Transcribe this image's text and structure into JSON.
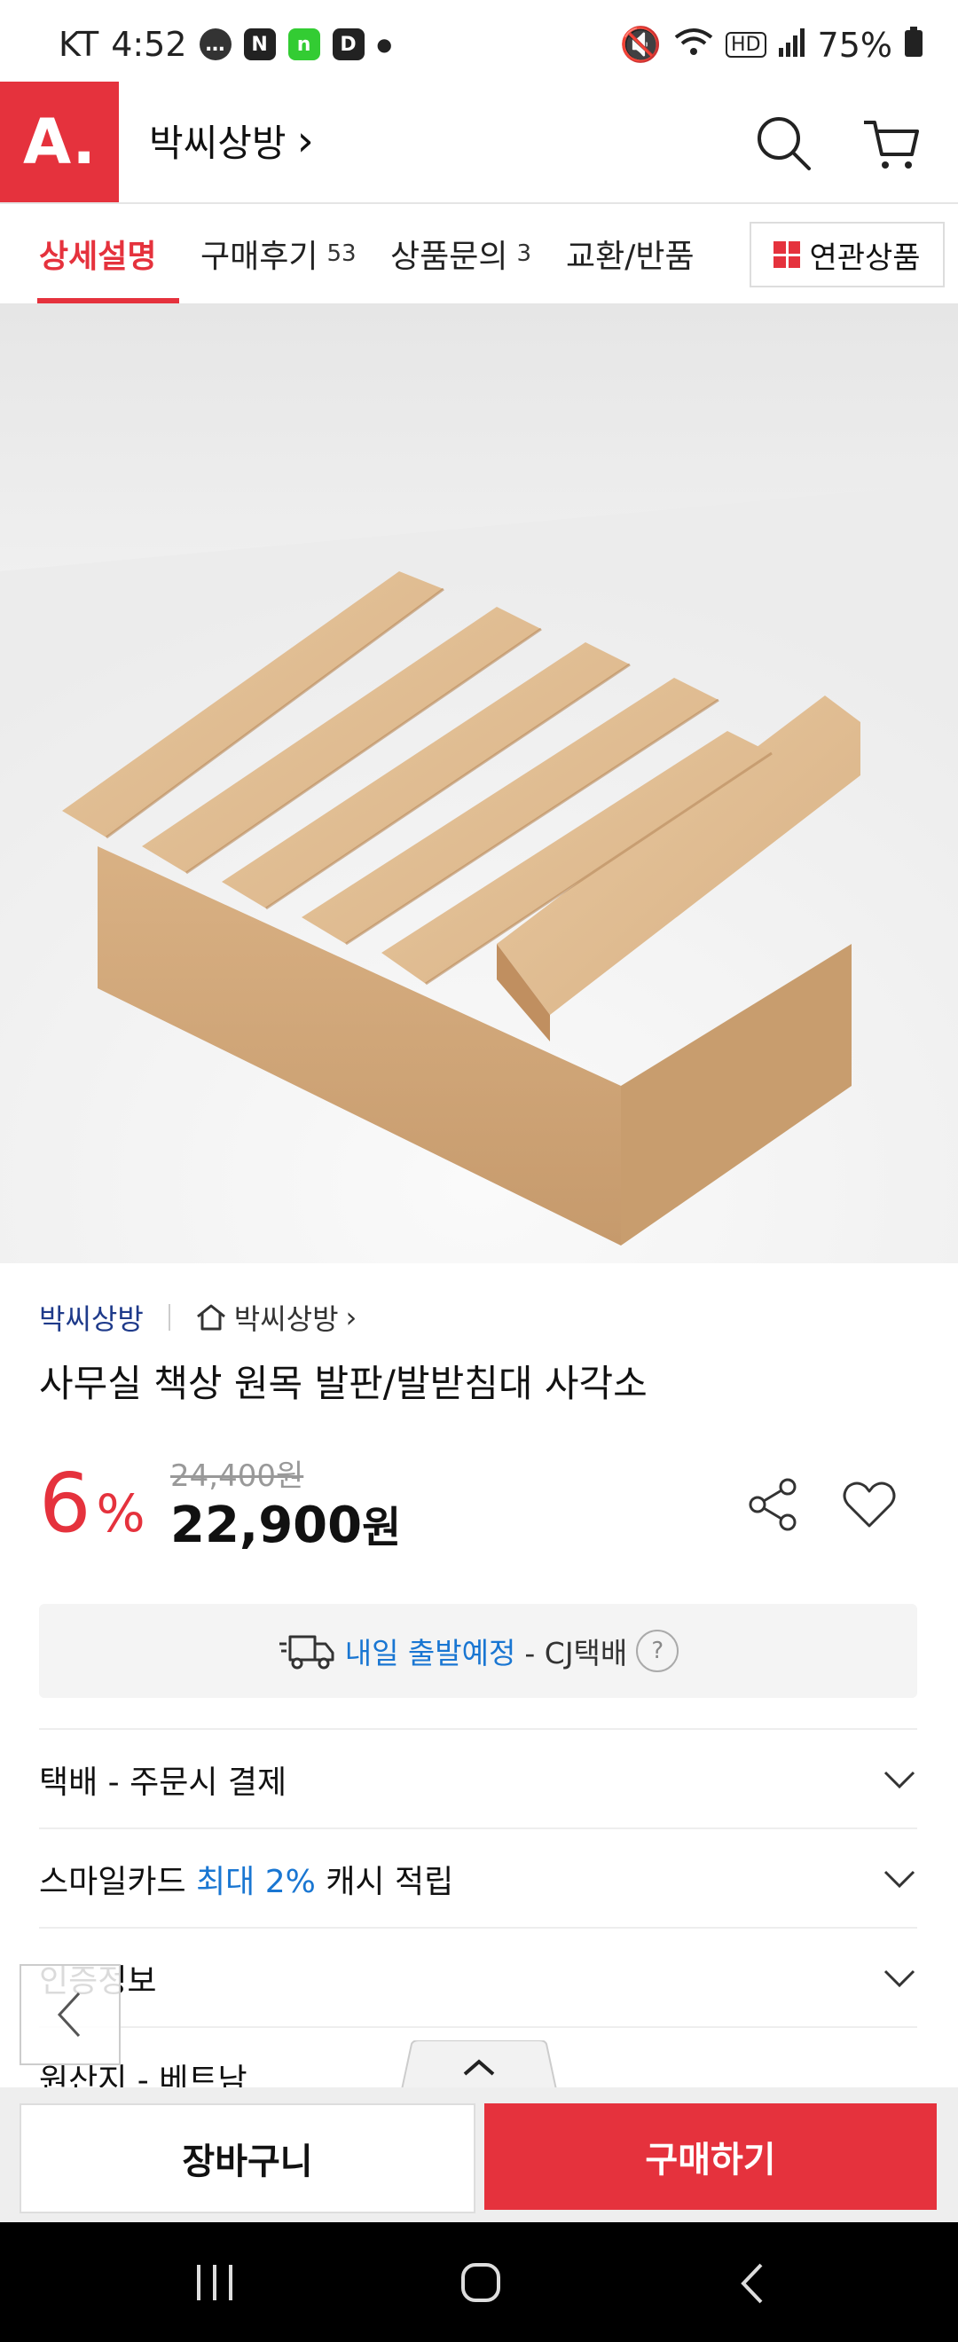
{
  "status_bar": {
    "carrier": "KT",
    "time": "4:52",
    "battery": "75%"
  },
  "header": {
    "store_name": "박씨상방",
    "store_arrow": "›"
  },
  "tabs": [
    {
      "label": "상세설명",
      "count": ""
    },
    {
      "label": "구매후기",
      "count": "53"
    },
    {
      "label": "상품문의",
      "count": "3"
    },
    {
      "label": "교환/반품",
      "count": ""
    }
  ],
  "related_label": "연관상품",
  "product": {
    "brand": "박씨상방",
    "shop_link": "박씨상방",
    "title": "사무실 책상 원목 발판/발받침대 사각소",
    "discount": "6",
    "discount_unit": "%",
    "original_price": "24,400원",
    "price": "22,900",
    "price_unit": "원"
  },
  "shipping": {
    "highlight": "내일 출발예정",
    "carrier": "- CJ택배",
    "help": "?"
  },
  "rows": [
    {
      "text": "택배 - 주문시 결제"
    },
    {
      "prefix": "스마일카드",
      "highlight": "최대 2%",
      "suffix": "캐시 적립"
    },
    {
      "text": "인증정보"
    },
    {
      "text": "원산지 - 베트남"
    }
  ],
  "bottom": {
    "cart": "장바구니",
    "buy": "구매하기"
  },
  "colors": {
    "accent": "#e5323d",
    "link_blue": "#1976d2",
    "brand_navy": "#1e3a8a"
  }
}
